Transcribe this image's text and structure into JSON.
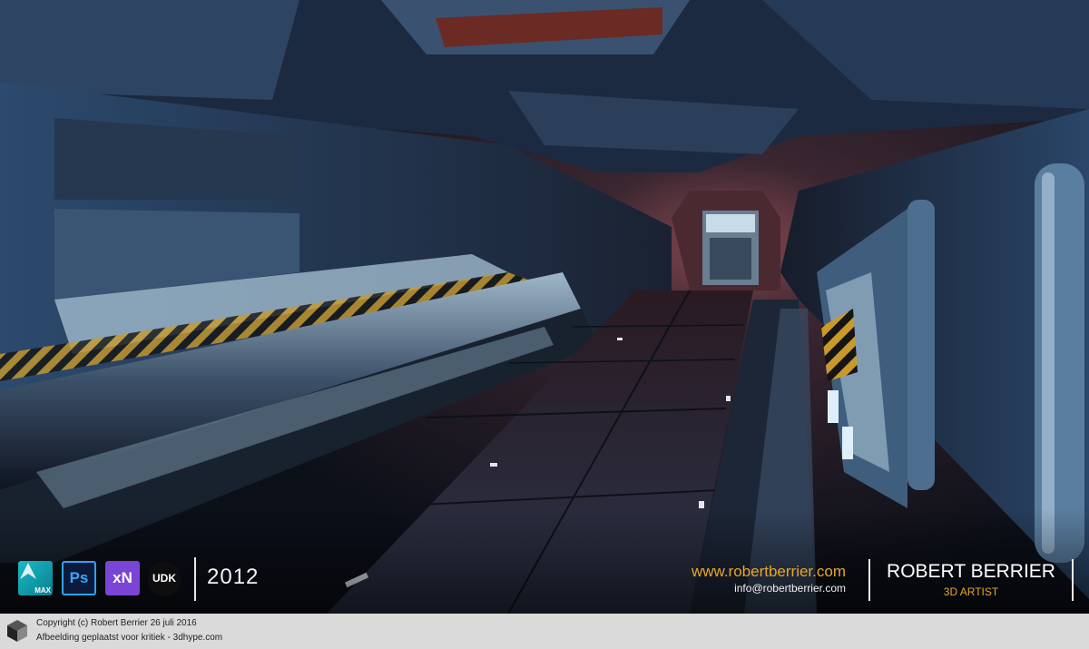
{
  "software_icons": [
    {
      "name": "3ds-max-icon",
      "label": "MAX"
    },
    {
      "name": "photoshop-icon",
      "label": "Ps"
    },
    {
      "name": "xnormal-icon",
      "label": "xN"
    },
    {
      "name": "udk-icon",
      "label": "UDK"
    }
  ],
  "year": "2012",
  "contact": {
    "website": "www.robertberrier.com",
    "email": "info@robertberrier.com"
  },
  "artist": {
    "name": "ROBERT BERRIER",
    "role": "3D ARTIST"
  },
  "footer": {
    "copyright": "Copyright (c) Robert Berrier 26 juli 2016",
    "posted": "Afbeelding geplaatst voor kritiek - 3dhype.com"
  },
  "colors": {
    "accent_orange": "#e6a72a",
    "footer_bg": "#dadada",
    "corridor_blue": "#1f3350"
  }
}
